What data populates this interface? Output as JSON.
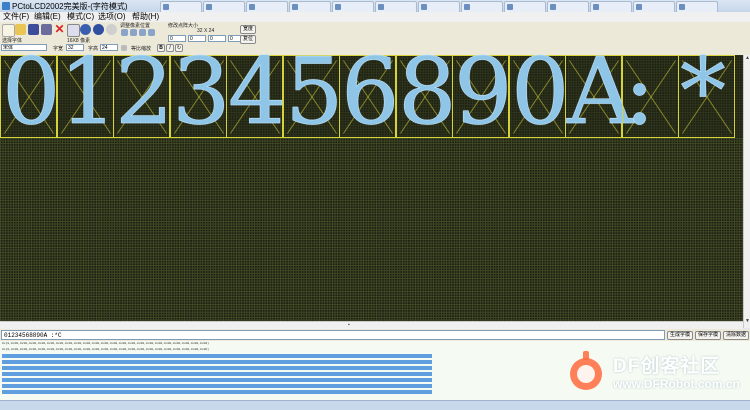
{
  "window": {
    "title": "PCtoLCD2002完美版-(字符模式)"
  },
  "menu": [
    "文件(F)",
    "编辑(E)",
    "模式(C)",
    "选项(O)",
    "帮助(H)"
  ],
  "toolbar": {
    "font_select": "宋体",
    "font_label": "选择字体",
    "width_label": "字宽",
    "width_value": "32",
    "height_label": "字高",
    "height_value": "24",
    "equal_scale_label": "等比缩放",
    "size_info": "16X8 像素",
    "adjust_label": "调整像素位置",
    "grid_size_label": "修改点阵大小",
    "grid_w": "0",
    "grid_h": "0",
    "grid_w2": "0",
    "grid_h2": "0",
    "dims": "32 X 24",
    "btn_right1": "宽度",
    "btn_right2": "复位"
  },
  "lcd": {
    "characters": [
      "0",
      "1",
      "2",
      "3",
      "4",
      "5",
      "6",
      "8",
      "9",
      "0",
      "A",
      ":",
      "*"
    ]
  },
  "input": {
    "text": "01234568890A :*C",
    "generate_label": "生成字模",
    "save_label": "保存字模",
    "clear_label": "清除数据"
  },
  "output": {
    "header_hex": "0x{0,0x00,0x00,0x00,0x00,0x00,0x00,0x00,0x00,0x00,0x00,0x00,0x00,0x00,0x00,0x00,0x00,0x00,0x00,0x00,0x00,0x00,0x00}"
  },
  "watermark": {
    "title": "DF创客社区",
    "url": "www.DFRobot.com.cn"
  },
  "colors": {
    "lcd_bg": "#1d1f12",
    "grid_line": "#d6d23a",
    "glyph": "#8fc6e8",
    "selection": "#5f9fe0"
  }
}
